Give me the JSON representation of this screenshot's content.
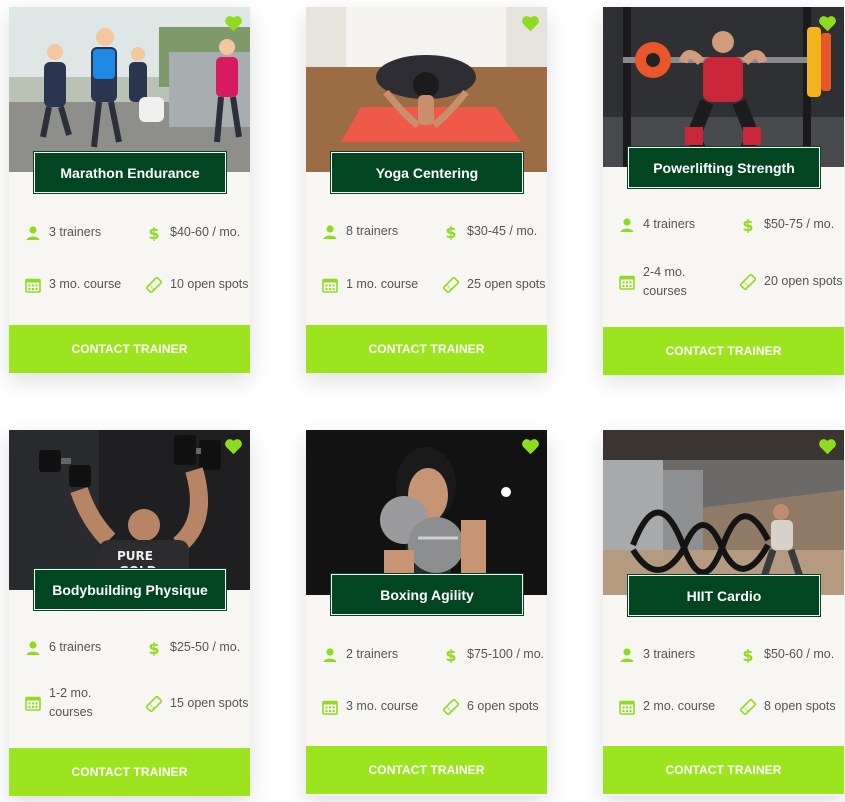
{
  "colors": {
    "accent": "#9be41e",
    "title_bg": "#024521",
    "card_bg": "#f7f6f3",
    "icon": "#8fdb1f"
  },
  "icons": {
    "trainers": "person-icon",
    "price": "dollar-icon",
    "duration": "calendar-icon",
    "spots": "ticket-icon",
    "favorite": "heart-icon"
  },
  "programs": [
    {
      "title": "Marathon Endurance",
      "trainers": "3 trainers",
      "price": "$40-60 / mo.",
      "duration": "3 mo. course",
      "spots": "10 open spots",
      "cta": "CONTACT TRAINER"
    },
    {
      "title": "Yoga Centering",
      "trainers": "8 trainers",
      "price": "$30-45 / mo.",
      "duration": "1 mo. course",
      "spots": "25 open spots",
      "cta": "CONTACT TRAINER"
    },
    {
      "title": "Powerlifting Strength",
      "trainers": "4 trainers",
      "price": "$50-75 / mo.",
      "duration": "2-4 mo. courses",
      "spots": "20 open spots",
      "cta": "CONTACT TRAINER"
    },
    {
      "title": "Bodybuilding Physique",
      "trainers": "6 trainers",
      "price": "$25-50 / mo.",
      "duration": "1-2 mo. courses",
      "spots": "15 open spots",
      "cta": "CONTACT TRAINER"
    },
    {
      "title": "Boxing Agility",
      "trainers": "2 trainers",
      "price": "$75-100 / mo.",
      "duration": "3 mo. course",
      "spots": "6 open spots",
      "cta": "CONTACT TRAINER"
    },
    {
      "title": "HIIT Cardio",
      "trainers": "3 trainers",
      "price": "$50-60 / mo.",
      "duration": "2 mo. course",
      "spots": "8 open spots",
      "cta": "CONTACT TRAINER"
    }
  ]
}
